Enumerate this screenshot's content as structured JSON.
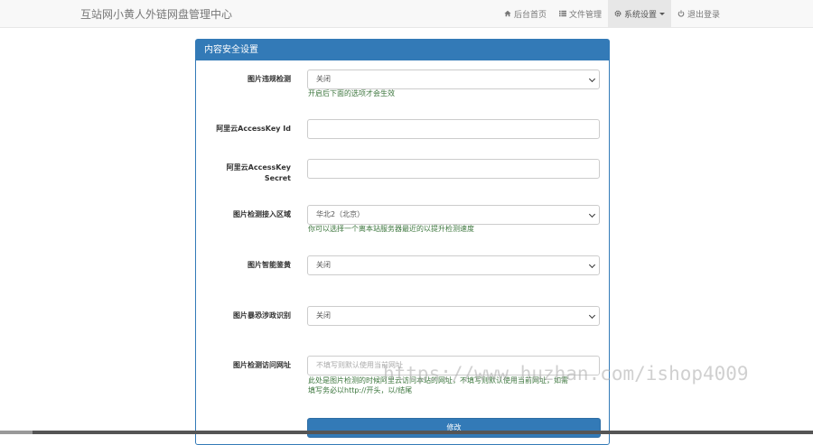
{
  "navbar": {
    "brand": "互站网小黄人外链网盘管理中心",
    "items": [
      {
        "label": "后台首页",
        "icon": "home-icon"
      },
      {
        "label": "文件管理",
        "icon": "list-icon"
      },
      {
        "label": "系统设置",
        "icon": "gear-icon"
      },
      {
        "label": "退出登录",
        "icon": "power-icon"
      }
    ]
  },
  "panel": {
    "title": "内容安全设置",
    "fields": [
      {
        "label": "图片违规检测",
        "value": "关闭",
        "help": "开启后下面的选项才会生效"
      },
      {
        "label": "阿里云AccessKey Id",
        "value": ""
      },
      {
        "label_line1": "阿里云AccessKey",
        "label_line2": "Secret",
        "value": ""
      },
      {
        "label": "图片检测接入区域",
        "value": "华北2（北京）",
        "help": "你可以选择一个离本站服务器最近的以提升检测速度"
      },
      {
        "label": "图片智能鉴黄",
        "value": "关闭"
      },
      {
        "label": "图片暴恐涉政识别",
        "value": "关闭"
      },
      {
        "label": "图片检测访问网址",
        "placeholder": "不填写则默认使用当前网址",
        "help_line1": "此处是图片检测的时候阿里云访问本站的网址，不填写则默认使用当前网址，如需",
        "help_line2": "填写务必以http://开头，以/结尾"
      }
    ],
    "submit_label": "修改"
  },
  "watermark": "https://www.huzhan.com/ishop4009",
  "colors": {
    "primary": "#337ab7",
    "help_text": "#3c763d",
    "navbar_bg": "#f8f8f8"
  }
}
